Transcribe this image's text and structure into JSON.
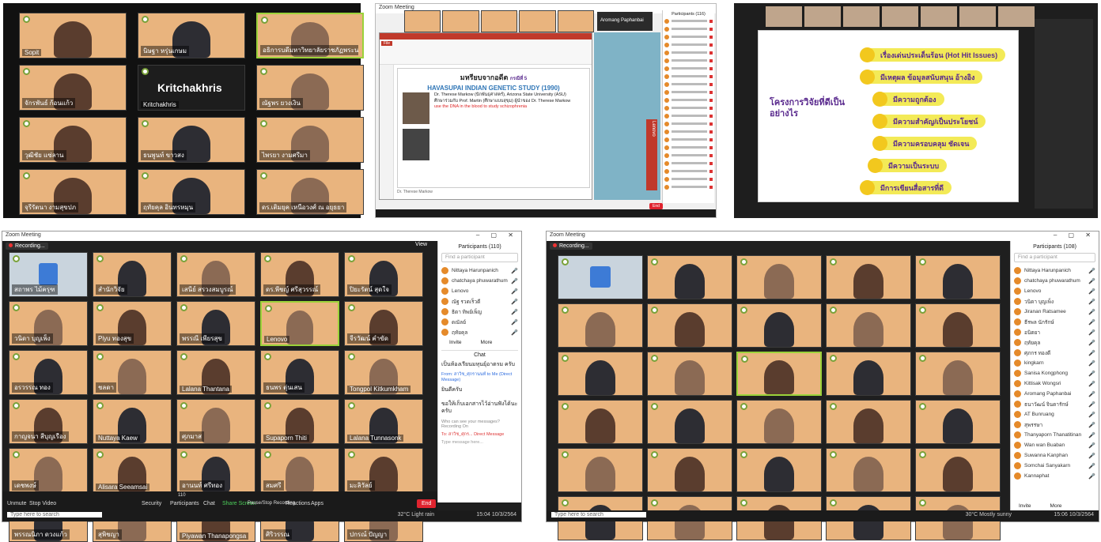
{
  "panel1": {
    "tiles": [
      {
        "label": "Sopit"
      },
      {
        "label": "นิษฐา หรุ่นเกษม"
      },
      {
        "label": "อธิการบดีมหาวิทยาลัยราชภัฏพระนคร"
      },
      {
        "label": "จักรพันธ์ ก้อนแก้ว"
      },
      {
        "label": "Kritchakhris",
        "big": "Kritchakhris"
      },
      {
        "label": "ณัฐพร ยวงเงิน"
      },
      {
        "label": "วุฒิชัย แซ่ลาน"
      },
      {
        "label": "ธนพูนท์ ขาวสง"
      },
      {
        "label": "ไพรยา งามศรีมา"
      },
      {
        "label": "จุรีรัตนา งามสุขปภ"
      },
      {
        "label": "ฤทัยคุล อินทรหมุน"
      },
      {
        "label": "ดร.เติมยุค เหนือวงศ์ ณ อยุธยา"
      }
    ]
  },
  "panel2": {
    "top_bar": "Zoom Meeting",
    "app_title": "Lenovo",
    "slide_heading": "มหรียบจากอดีต",
    "slide_subheading": "กรณีที่ 5",
    "study_title": "HAVASUPAI INDIAN GENETIC STUDY (1990)",
    "body_1": "Dr. Therese Markow (นักพันธุศาสตร์), Arizona State University (ASU)",
    "body_2": "ศึกษาร่วมกับ Prof. Martin (ศึกษาแบบสุขุม) ผู้นำของ Dr. Therese Markow",
    "body_3": "use the DNA in the blood to study schizophrenia",
    "footer": "Dr. Therese Markow",
    "names": [
      "Aromang Paphanbai",
      "Kritchakhris",
      "Sopit",
      "Lenovo"
    ],
    "panel_title": "Participants (116)",
    "end_label": "End"
  },
  "panel3": {
    "left_title": "โครงการวิจัยที่ดีเป็นอย่างไร",
    "items": [
      "เรื่องเด่นประเด็นร้อน (Hot Hit Issues)",
      "มีเหตุผล ข้อมูลสนับสนุน อ้างอิง",
      "มีความถูกต้อง",
      "มีความสำคัญ/เป็นประโยชน์",
      "มีความครอบคลุม ชัดเจน",
      "มีความเป็นระบบ",
      "มีการเขียนสื่อสารที่ดี"
    ]
  },
  "panel4": {
    "title": "Zoom Meeting",
    "recording": "Recording...",
    "view_label": "View",
    "participants_title": "Participants (110)",
    "search_placeholder": "Find a participant",
    "participants": [
      "Nittaya Harunpanich",
      "chatchaya phuwarathum",
      "Lenovo",
      "ณัฐ รวดเร็วดี",
      "ธิดา ทิพย์เพ็ญ",
      "ดณัลย์",
      "ฤทัยคุล"
    ],
    "invite_label": "Invite",
    "more_label": "More",
    "chat_title": "Chat",
    "chat_msg_1": "เป็นห้องเรียนมหุนยุ์อาตรม ครับ",
    "chat_from": "From: สาวิช_ศุกรานนท์ to Me (Direct Message)",
    "chat_msg_2": "ยินดีครับ",
    "chat_msg_3": "ขอให้เก็บเอกสารไว้อ่านฟังได้นะครับ",
    "chat_hint": "Who can see your messages? Recording On",
    "chat_to": "To: สาวิช_ศุกร... Direct Message",
    "chat_input": "Type message here...",
    "tiles": [
      "สถาพร ไม้ครุฑ",
      "สำนักวิจัย",
      "เสนีย์ สรวงสมบูรณ์",
      "ดร.พีชญ์ ศรีสุวรรณ์",
      "ปิยะรัตน์ สุดใจ",
      "วนิดา บุญเพ็ง",
      "Piyu ทองสุข",
      "พรรณี เพียรสุข",
      "Lenovo",
      "จีรวัฒน์ คำขัด",
      "อรวรรณ ทอง",
      "ชลดา",
      "Lalana Thantana",
      "ธนพร ตุ่นเสน",
      "Tongpol Kitkumkham",
      "กาญจนา สีบุญเรือง",
      "Nuttaya Kaew",
      "ศุภมาส",
      "Supaporn Thiti",
      "Lalana Tunnasonk",
      "เดชพงษ์",
      "Alisara Seeamsai",
      "อานนท์ ศรีทอง",
      "สมศรี",
      "มะลิวัลย์",
      "พรรณนิภา ดวงแก้ว",
      "สุพิชญา",
      "Piyawan Thanapongsa",
      "ศิริวรรณ",
      "ปกรณ์ ปัญญา"
    ],
    "toolbar": [
      "Unmute",
      "Stop Video",
      "Security",
      "Participants",
      "Chat",
      "Share Screen",
      "Pause/Stop Recording",
      "Reactions",
      "Apps"
    ],
    "participants_count": "110",
    "end_label": "End",
    "taskbar_search": "Type here to search",
    "weather": "32°C Light rain",
    "clock": "15:04 10/3/2564"
  },
  "panel5": {
    "title": "Zoom Meeting",
    "recording": "Recording...",
    "participants_title": "Participants (108)",
    "search_placeholder": "Find a participant",
    "participants": [
      "Nittaya Harunpanich",
      "chatchaya phuwarathum",
      "Lenovo",
      "วนิดา บุญเพ็ง",
      "Jiranan Ratsamee",
      "ธีรพล นักรักษ์",
      "อนิตยา",
      "ฤทัยคุล",
      "ศุภกร ทองดี",
      "kingkarn",
      "Sanisa Kongphong",
      "Kittisak Wongsri",
      "Aromang Paphanbai",
      "ธนาวัฒน์ จินดารักษ์",
      "AT Bunruang",
      "สุพรรษา",
      "Thanyaporn Thanatitinan",
      "Wan wan Buaban",
      "Suwanna Kanphan",
      "Somchai Sanyakarn",
      "Kannaphat"
    ],
    "invite_label": "Invite",
    "more_label": "More",
    "taskbar_search": "Type here to search",
    "weather": "30°C Mostly sunny",
    "clock": "15:06 10/3/2564",
    "tiles": [
      "",
      "",
      "",
      "",
      "",
      "",
      "",
      "",
      "",
      "",
      "",
      "",
      "",
      "",
      "",
      "",
      "",
      "",
      "",
      "",
      "",
      "",
      "",
      "",
      "",
      "",
      "",
      "",
      "",
      ""
    ]
  }
}
